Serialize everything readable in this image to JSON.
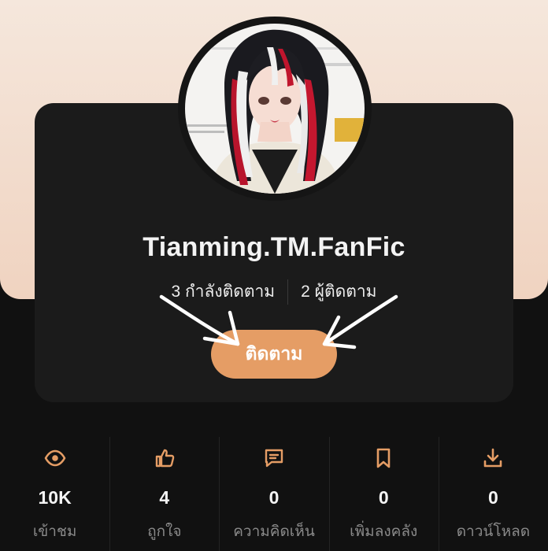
{
  "profile": {
    "username": "Tianming.TM.FanFic",
    "following": "3 กำลังติดตาม",
    "followers": "2 ผู้ติดตาม",
    "follow_button": "ติดตาม"
  },
  "metrics": [
    {
      "icon": "eye-icon",
      "value": "10K",
      "label": "เข้าชม"
    },
    {
      "icon": "thumbs-up-icon",
      "value": "4",
      "label": "ถูกใจ"
    },
    {
      "icon": "comment-icon",
      "value": "0",
      "label": "ความคิดเห็น"
    },
    {
      "icon": "bookmark-icon",
      "value": "0",
      "label": "เพิ่มลงคลัง"
    },
    {
      "icon": "download-icon",
      "value": "0",
      "label": "ดาวน์โหลด"
    }
  ],
  "colors": {
    "accent": "#e59d65",
    "card": "#1b1b1b",
    "background": "#111111",
    "header_gradient": "#f2dccd"
  }
}
